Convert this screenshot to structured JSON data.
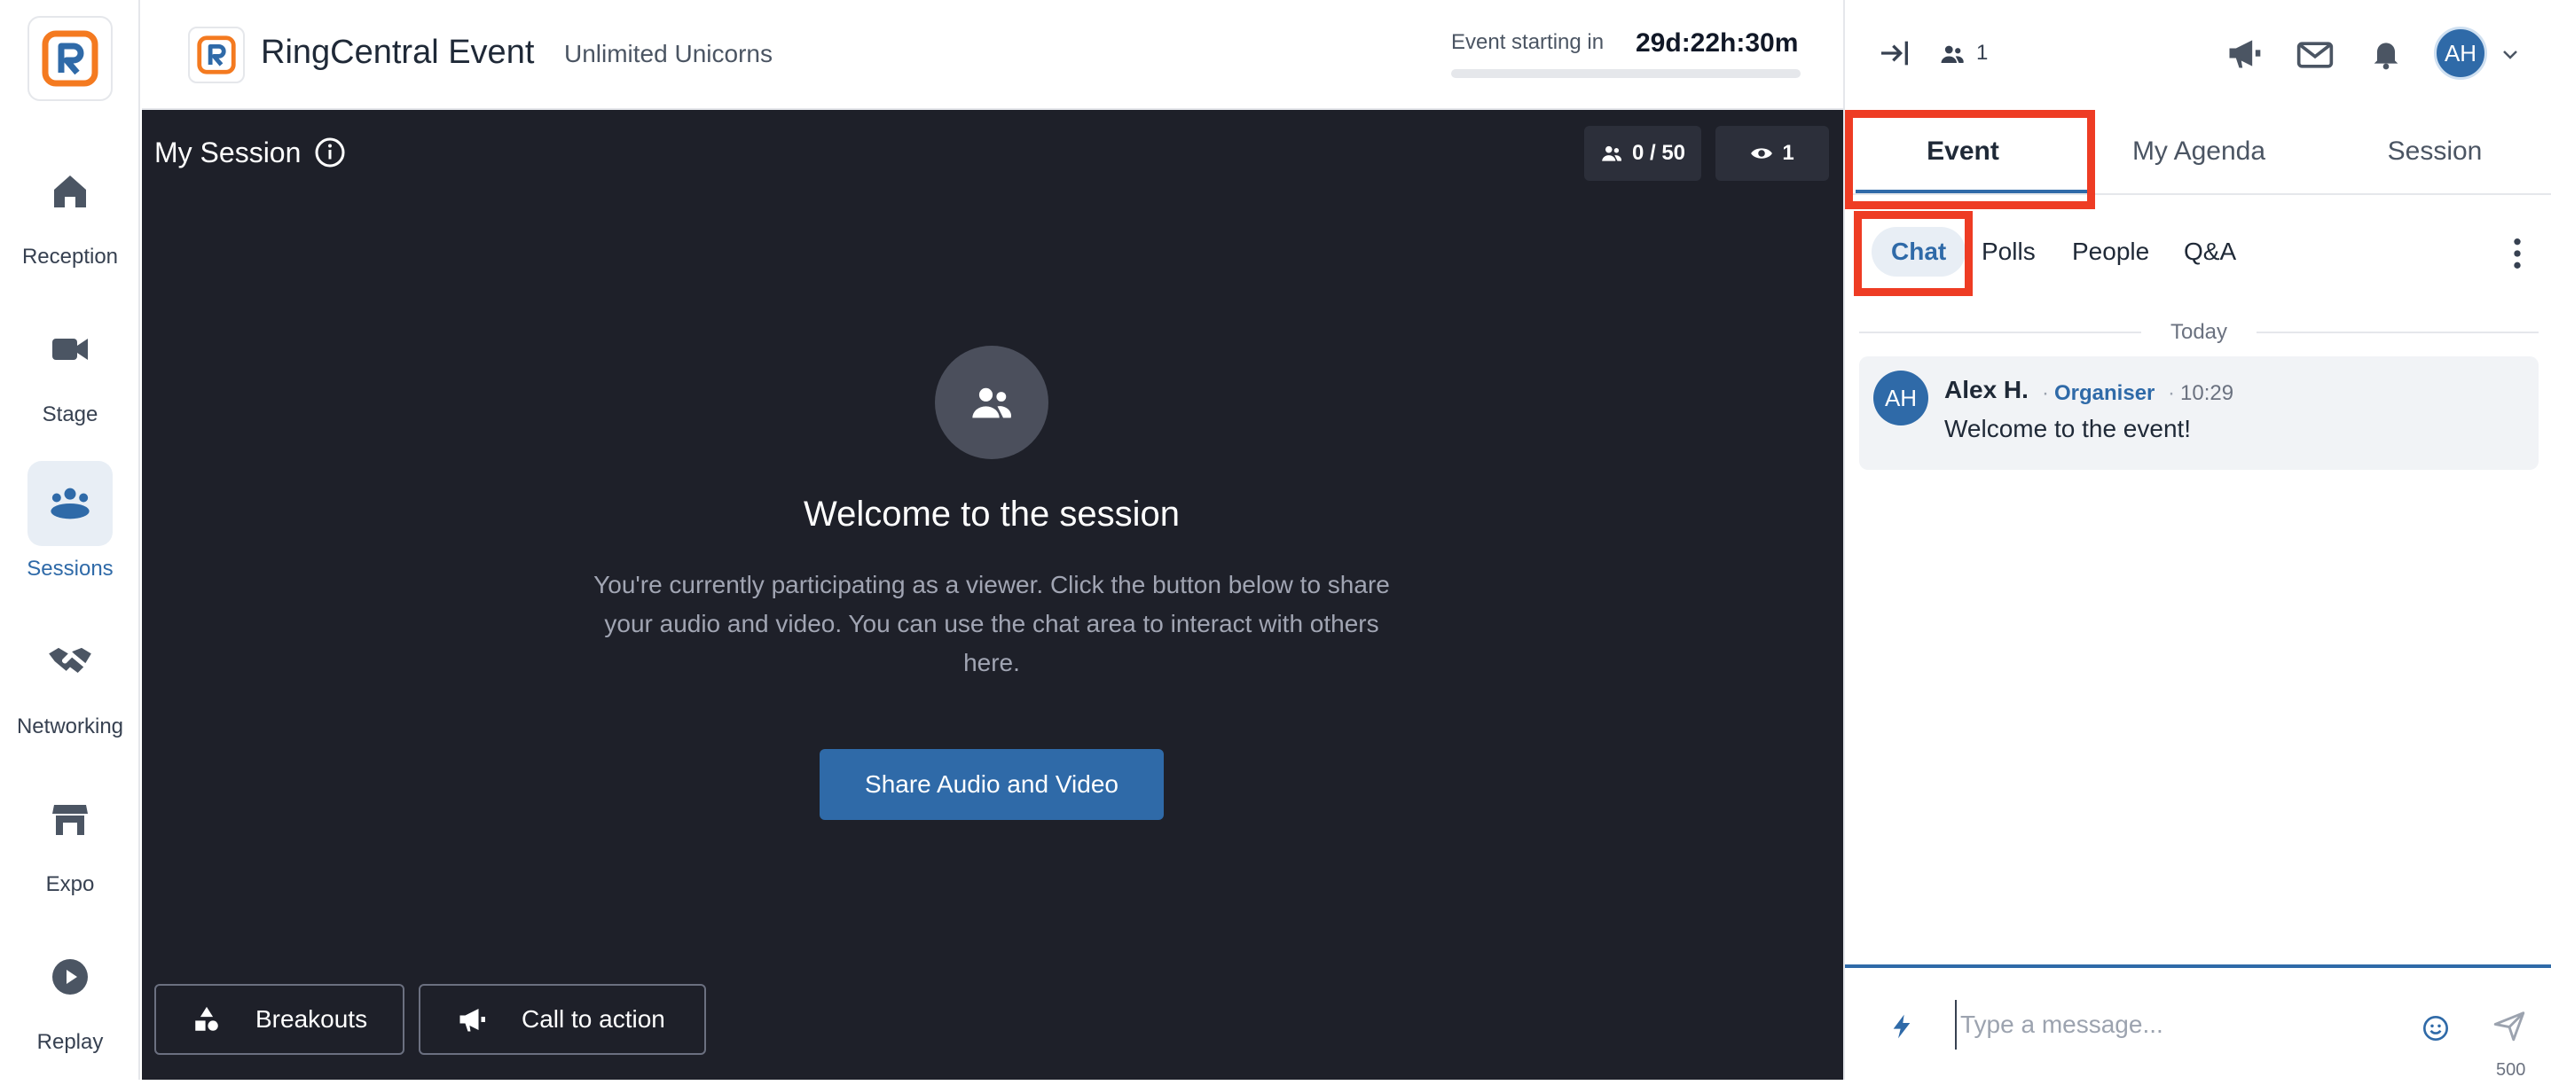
{
  "nav": {
    "items": [
      {
        "label": "Reception",
        "icon": "home-icon"
      },
      {
        "label": "Stage",
        "icon": "video-camera-icon"
      },
      {
        "label": "Sessions",
        "icon": "group-icon",
        "active": true
      },
      {
        "label": "Networking",
        "icon": "handshake-icon"
      },
      {
        "label": "Expo",
        "icon": "booth-icon"
      },
      {
        "label": "Replay",
        "icon": "play-icon"
      }
    ]
  },
  "topbar": {
    "brand_name": "RingCentral Event",
    "org_name": "Unlimited Unicorns",
    "countdown_label": "Event starting in",
    "countdown_value": "29d:22h:30m"
  },
  "stage": {
    "session_title": "My Session",
    "capacity": "0 / 50",
    "viewers": "1",
    "welcome_title": "Welcome to the session",
    "welcome_text": "You're currently participating as a viewer. Click the button below to share your audio and video. You can use the chat area to interact with others here.",
    "share_button": "Share Audio and Video",
    "breakouts_button": "Breakouts",
    "cta_button": "Call to action"
  },
  "panel": {
    "attendee_count": "1",
    "user_initials": "AH",
    "tabs": {
      "event": "Event",
      "agenda": "My Agenda",
      "session": "Session"
    },
    "subtabs": {
      "chat": "Chat",
      "polls": "Polls",
      "people": "People",
      "qa": "Q&A"
    },
    "today": "Today",
    "message": {
      "initials": "AH",
      "author": "Alex H.",
      "role": "Organiser",
      "time": "10:29",
      "text": "Welcome to the event!"
    },
    "composer": {
      "placeholder": "Type a message...",
      "char_limit": "500"
    }
  },
  "colors": {
    "accent": "#2f6aa8",
    "highlight": "#ee3c24",
    "stage_bg": "#1e2029",
    "logo_orange": "#f47a20"
  }
}
